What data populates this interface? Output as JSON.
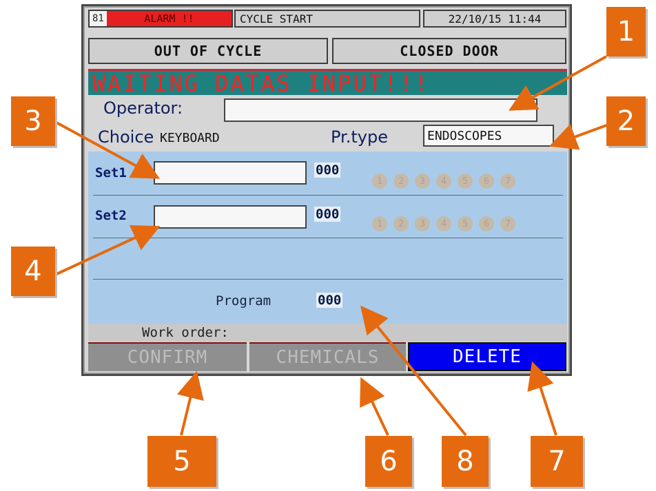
{
  "header": {
    "alarm_code": "81",
    "alarm_text": "ALARM !!",
    "cycle_text": "CYCLE START",
    "datetime": "22/10/15  11:44"
  },
  "state": {
    "cycle_state": "OUT OF CYCLE",
    "door_state": "CLOSED DOOR"
  },
  "status_message": "WAITING DATAS INPUT!!!",
  "operator": {
    "label": "Operator:",
    "value": ""
  },
  "choice": {
    "label": "Choice",
    "value": "KEYBOARD"
  },
  "program_type": {
    "label": "Pr.type",
    "value": "ENDOSCOPES"
  },
  "sets": [
    {
      "label": "Set1",
      "value": "",
      "count": "000",
      "slots": [
        "1",
        "2",
        "3",
        "4",
        "5",
        "6",
        "7"
      ]
    },
    {
      "label": "Set2",
      "value": "",
      "count": "000",
      "slots": [
        "1",
        "2",
        "3",
        "4",
        "5",
        "6",
        "7"
      ]
    }
  ],
  "program": {
    "label": "Program",
    "value": "000"
  },
  "work_order": {
    "label": "Work order:"
  },
  "buttons": {
    "confirm": "CONFIRM",
    "chemicals": "CHEMICALS",
    "delete": "DELETE"
  },
  "callouts": [
    "1",
    "2",
    "3",
    "4",
    "5",
    "6",
    "7",
    "8"
  ],
  "colors": {
    "callout": "#e56a0f",
    "alarm": "#e62020",
    "status_bg": "#1f8080",
    "delete_btn": "#0000f0",
    "set_area": "#a9cbe9"
  }
}
